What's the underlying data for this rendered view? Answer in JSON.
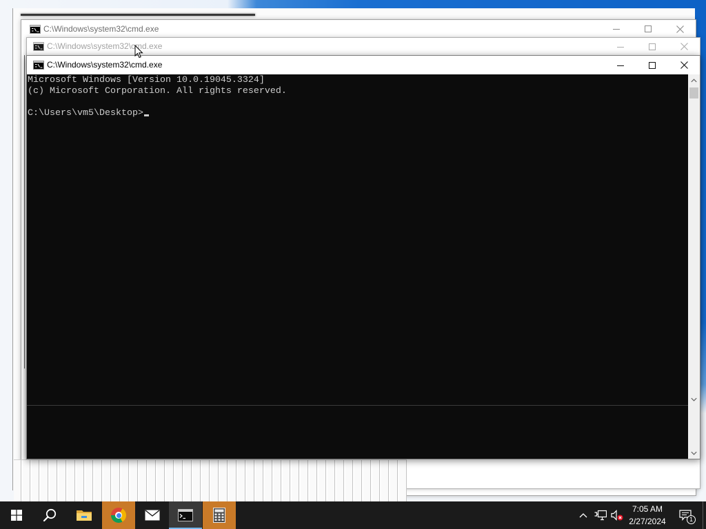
{
  "desktop": {
    "wallpaper_blue": "#0d62c6"
  },
  "windows": {
    "back": {
      "title": "C:\\Windows\\system32\\cmd.exe",
      "icon": "command-prompt-icon"
    },
    "middle": {
      "title": "C:\\Windows\\system32\\cmd.exe",
      "icon": "command-prompt-icon"
    },
    "front": {
      "title": "C:\\Windows\\system32\\cmd.exe",
      "icon": "command-prompt-icon",
      "active": true
    }
  },
  "console": {
    "lines": [
      "Microsoft Windows [Version 10.0.19045.3324]",
      "(c) Microsoft Corporation. All rights reserved.",
      "",
      "C:\\Users\\vm5\\Desktop>"
    ],
    "background": "#0c0c0c",
    "foreground": "#cccccc"
  },
  "taskbar": {
    "start_icon": "windows-logo-icon",
    "search_icon": "search-icon",
    "apps": [
      {
        "icon": "file-explorer-icon",
        "flashing": false,
        "active": false
      },
      {
        "icon": "chrome-icon",
        "flashing": true,
        "active": false
      },
      {
        "icon": "mail-icon",
        "flashing": false,
        "active": false
      },
      {
        "icon": "command-prompt-icon",
        "flashing": false,
        "active": true
      },
      {
        "icon": "calculator-icon",
        "flashing": true,
        "active": false
      }
    ],
    "tray": {
      "icons": [
        "chevron-up-icon",
        "network-icon",
        "volume-muted-icon"
      ],
      "clock": {
        "time": "7:05 AM",
        "date": "2/27/2024"
      },
      "action_center": {
        "icon": "action-center-icon",
        "badge": "1"
      }
    },
    "colors": {
      "background": "#1b1b1b",
      "flash": "#c97a28",
      "active_underline": "#76b9ed"
    }
  },
  "pointer": {
    "icon": "arrow-cursor-icon"
  }
}
